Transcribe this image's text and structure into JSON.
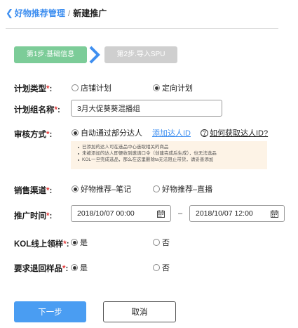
{
  "breadcrumb": {
    "back_icon": "chevron-left-icon",
    "parent": "好物推荐管理",
    "separator": "/",
    "current": "新建推广"
  },
  "steps": [
    {
      "label": "第1步.基础信息",
      "state": "active",
      "color": "#7ccc98"
    },
    {
      "label": "第2步.导入SPU",
      "state": "inactive",
      "color": "#cfcfcf"
    }
  ],
  "step_arrow_icon": "chevron-right-icon",
  "accent_color": "#3f8ff0",
  "required_mark": "*",
  "form": {
    "plan_type": {
      "label": "计划类型",
      "options": [
        {
          "label": "店铺计划",
          "selected": false
        },
        {
          "label": "定向计划",
          "selected": true
        }
      ]
    },
    "group_name": {
      "label": "计划组名称",
      "value": "3月大促葵葵混播组"
    },
    "review": {
      "label": "审核方式",
      "option": {
        "label": "自动通过部分达人",
        "selected": true
      },
      "add_link": "添加达人ID",
      "help_icon": "question-circle-icon",
      "help_link": "如何获取达人ID?",
      "notes": [
        "已添加的达人可在选品中心选取相关的商品",
        "未被添加的达人即便收到邀请口令（创建完成后生成），也无法选品",
        "KOL一旦完成选品，那么在这里删除ta无法阻止带货，请妥善添加"
      ]
    },
    "channel": {
      "label": "销售渠道",
      "options": [
        {
          "label": "好物推荐–笔记",
          "selected": true
        },
        {
          "label": "好物推荐–直播",
          "selected": false
        }
      ]
    },
    "promo_time": {
      "label": "推广时间",
      "start": "2018/10/07 00:00",
      "end": "2018/10/07 12:00",
      "separator": "–",
      "calendar_icon": "calendar-icon"
    },
    "kol_sample": {
      "label": "KOL线上领样",
      "options": [
        {
          "label": "是",
          "selected": true
        },
        {
          "label": "否",
          "selected": false
        }
      ]
    },
    "return_sample": {
      "label": "要求退回样品",
      "options": [
        {
          "label": "是",
          "selected": true
        },
        {
          "label": "否",
          "selected": false
        }
      ]
    }
  },
  "buttons": {
    "next": "下一步",
    "cancel": "取消"
  }
}
